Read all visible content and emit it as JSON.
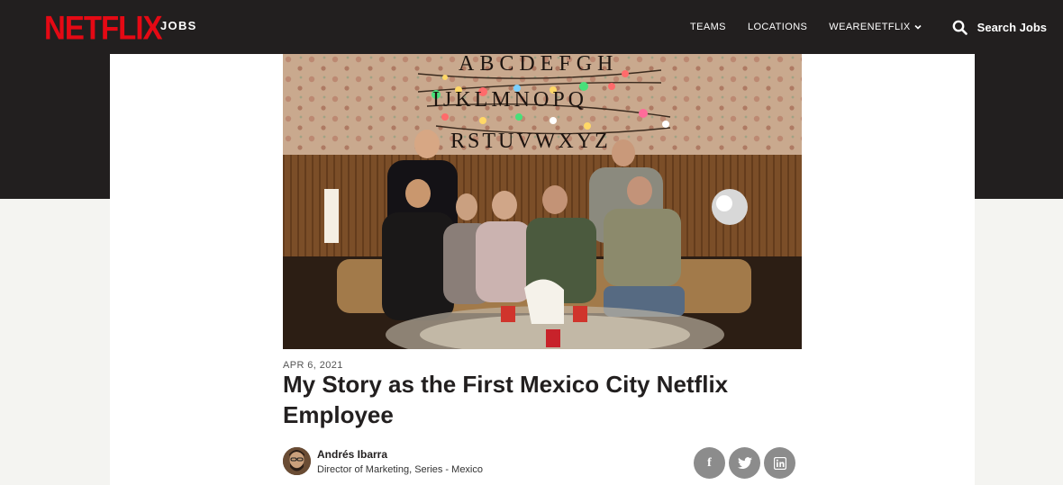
{
  "header": {
    "logo_text": "NETFLIX",
    "jobs_label": "JOBS",
    "nav": [
      {
        "label": "TEAMS"
      },
      {
        "label": "LOCATIONS"
      },
      {
        "label": "WEARENETFLIX"
      }
    ],
    "search_label": "Search Jobs"
  },
  "article": {
    "date": "APR 6, 2021",
    "title": "My Story as the First Mexico City Netflix Employee",
    "author_name": "Andrés Ibarra",
    "author_role": "Director of Marketing, Series - Mexico",
    "wall_letters": [
      "ABCDEFGH",
      "IJKLMNOPQ",
      "RSTUVWXYZ"
    ]
  },
  "share": [
    {
      "label": "f",
      "icon": "facebook-icon"
    },
    {
      "label": "twitter",
      "icon": "twitter-icon"
    },
    {
      "label": "in",
      "icon": "linkedin-icon"
    }
  ],
  "colors": {
    "brand_red": "#e50914",
    "header_bg": "#221f1f",
    "page_bg": "#f4f4f1",
    "share_bg": "#8c8c8c"
  }
}
